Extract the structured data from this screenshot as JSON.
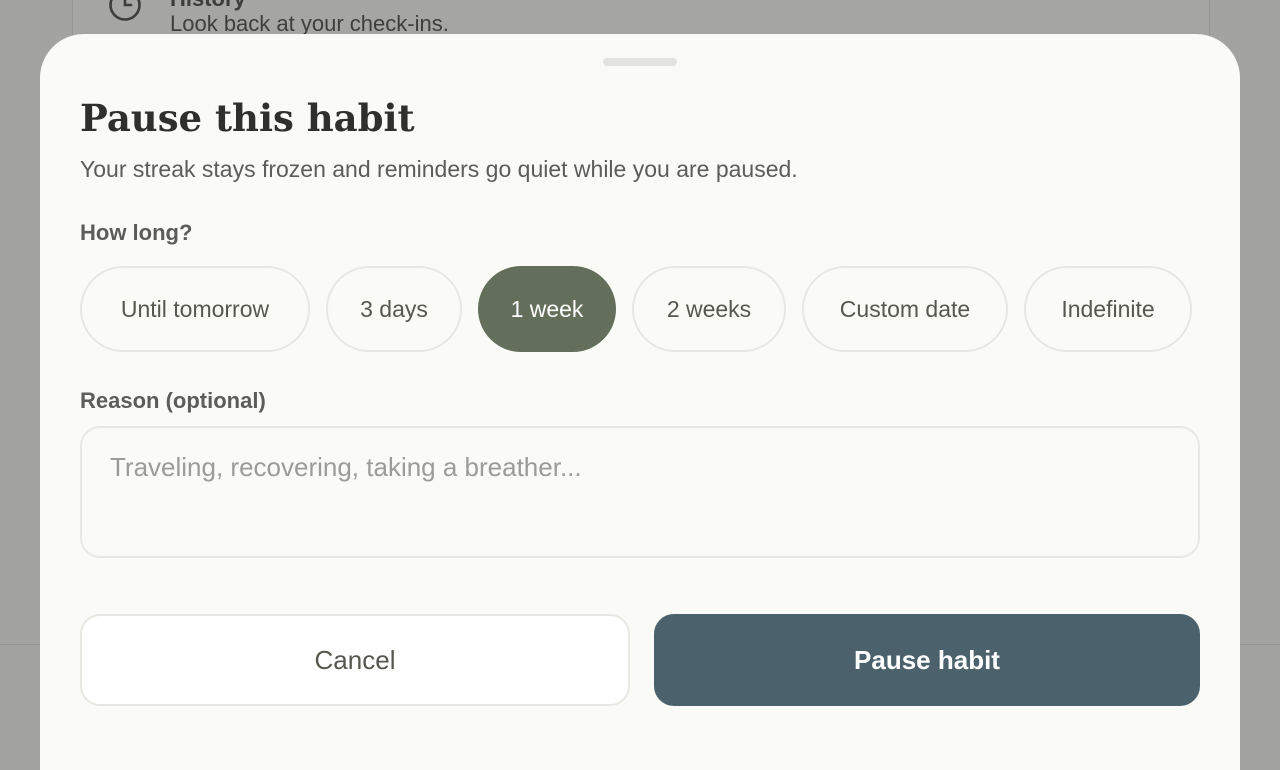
{
  "background": {
    "row_title": "History",
    "row_subtitle": "Look back at your check-ins.",
    "icon": "clock-icon"
  },
  "sheet": {
    "title": "Pause this habit",
    "subtitle": "Your streak stays frozen and reminders go quiet while you are paused.",
    "duration_label": "How long?",
    "durations": [
      {
        "label": "Until tomorrow",
        "selected": false
      },
      {
        "label": "3 days",
        "selected": false
      },
      {
        "label": "1 week",
        "selected": true
      },
      {
        "label": "2 weeks",
        "selected": false
      },
      {
        "label": "Custom date",
        "selected": false
      },
      {
        "label": "Indefinite",
        "selected": false
      }
    ],
    "reason_label": "Reason (optional)",
    "reason_placeholder": "Traveling, recovering, taking a breather...",
    "reason_value": "",
    "cancel_label": "Cancel",
    "confirm_label": "Pause habit"
  },
  "colors": {
    "selected_chip": "#636f5b",
    "primary_button": "#4b626c",
    "sheet_background": "#fafaf7"
  }
}
